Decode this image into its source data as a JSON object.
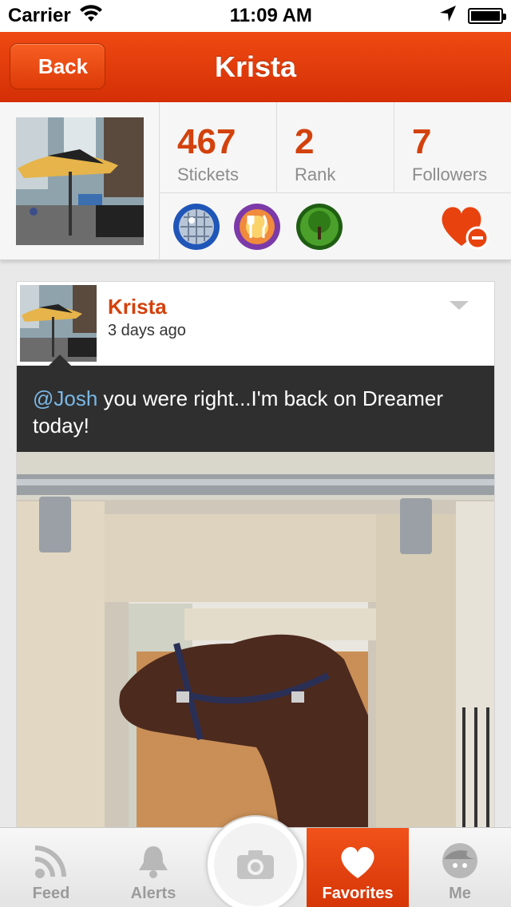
{
  "status_bar": {
    "carrier": "Carrier",
    "time": "11:09 AM",
    "icons": [
      "wifi-icon",
      "location-arrow-icon",
      "battery-icon"
    ]
  },
  "nav": {
    "back_label": "Back",
    "title": "Krista"
  },
  "profile": {
    "stats": [
      {
        "value": "467",
        "label": "Stickets"
      },
      {
        "value": "2",
        "label": "Rank"
      },
      {
        "value": "7",
        "label": "Followers"
      }
    ],
    "badges": [
      "disco-ball-badge",
      "restaurant-badge",
      "tree-badge"
    ],
    "favorite_icon": "heart-minus-icon"
  },
  "post": {
    "author": "Krista",
    "time_ago": "3 days ago",
    "mention": "@Josh",
    "message": " you were right...I'm back on Dreamer today!"
  },
  "tabs": [
    {
      "label": "Feed",
      "icon": "rss-icon"
    },
    {
      "label": "Alerts",
      "icon": "bell-icon"
    },
    {
      "label": "Favorites",
      "icon": "heart-icon"
    },
    {
      "label": "Me",
      "icon": "face-icon"
    }
  ],
  "colors": {
    "accent": "#d3410c",
    "nav_bar": "#e23d0b",
    "mention": "#7ab8e6",
    "message_bg": "#2f2f2f"
  }
}
